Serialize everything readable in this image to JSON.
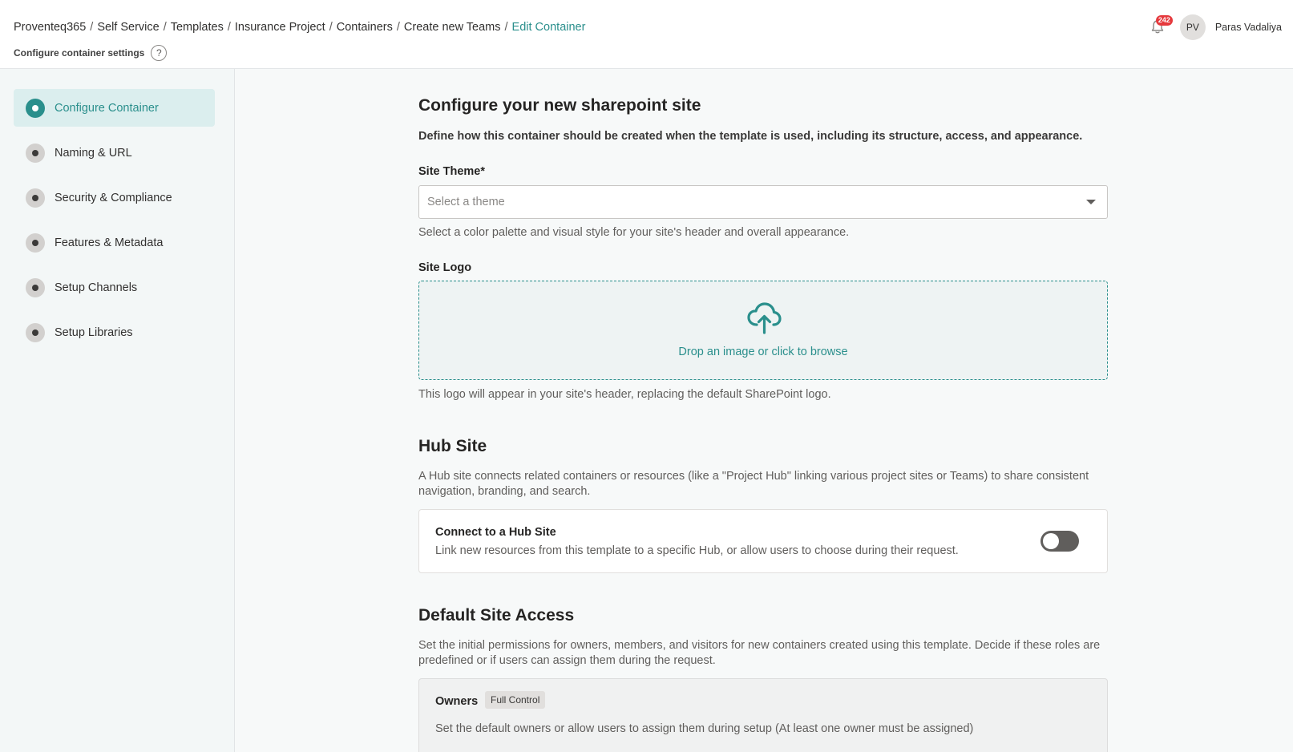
{
  "breadcrumb": {
    "items": [
      "Proventeq365",
      "Self Service",
      "Templates",
      "Insurance Project",
      "Containers",
      "Create new Teams"
    ],
    "current": "Edit Container"
  },
  "page": {
    "subtitle": "Configure container settings",
    "help_symbol": "?"
  },
  "user": {
    "notification_count": "242",
    "initials": "PV",
    "name": "Paras Vadaliya"
  },
  "sidebar": {
    "items": [
      {
        "label": "Configure Container",
        "active": true
      },
      {
        "label": "Naming & URL",
        "active": false
      },
      {
        "label": "Security & Compliance",
        "active": false
      },
      {
        "label": "Features & Metadata",
        "active": false
      },
      {
        "label": "Setup Channels",
        "active": false
      },
      {
        "label": "Setup Libraries",
        "active": false
      }
    ]
  },
  "main": {
    "title": "Configure your new sharepoint site",
    "lead": "Define how this container should be created when the template is used, including its structure, access, and appearance.",
    "site_theme": {
      "label": "Site Theme*",
      "placeholder": "Select a theme",
      "hint": "Select a color palette and visual style for your site's header and overall appearance."
    },
    "site_logo": {
      "label": "Site Logo",
      "drop_text": "Drop an image or click to browse",
      "hint": "This logo will appear in your site's header, replacing the default SharePoint logo."
    },
    "hub_site": {
      "title": "Hub Site",
      "description": "A Hub site connects related containers or resources (like a \"Project Hub\" linking various project sites or Teams) to share consistent navigation, branding, and search.",
      "card_title": "Connect to a Hub Site",
      "card_desc": "Link new resources from this template to a specific Hub, or allow users to choose during their request.",
      "enabled": false
    },
    "default_access": {
      "title": "Default Site Access",
      "description": "Set the initial permissions for owners, members, and visitors for new containers created using this template. Decide if these roles are predefined or if users can assign them during the request.",
      "owners": {
        "label": "Owners",
        "tag": "Full Control",
        "desc": "Set the default owners or allow users to assign them during setup (At least one owner must be assigned)"
      }
    }
  },
  "colors": {
    "accent": "#2a8f8c",
    "sidebar_bg": "#f3f7f7",
    "badge": "#e5393d"
  }
}
